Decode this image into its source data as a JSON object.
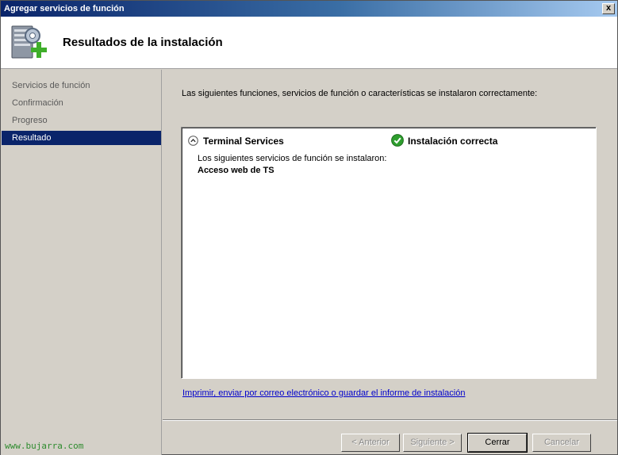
{
  "window": {
    "title": "Agregar servicios de función",
    "close_label": "x"
  },
  "header": {
    "title": "Resultados de la instalación",
    "icon": "server-gear-add-icon"
  },
  "sidebar": {
    "steps": [
      {
        "label": "Servicios de función",
        "active": false
      },
      {
        "label": "Confirmación",
        "active": false
      },
      {
        "label": "Progreso",
        "active": false
      },
      {
        "label": "Resultado",
        "active": true
      }
    ],
    "site": "www.bujarra.com"
  },
  "main": {
    "intro": "Las siguientes funciones, servicios de función o características se instalaron correctamente:",
    "results": [
      {
        "role": "Terminal Services",
        "status": "Instalación correcta",
        "detail": "Los siguientes servicios de función se instalaron:",
        "services": [
          "Acceso web de TS"
        ]
      }
    ],
    "report_link": "Imprimir, enviar por correo electrónico o guardar el informe de instalación"
  },
  "buttons": {
    "back": "< Anterior",
    "next": "Siguiente >",
    "close": "Cerrar",
    "cancel": "Cancelar"
  },
  "colors": {
    "titlebar": "#0a246a",
    "selection": "#0a246a",
    "link": "#0000cc",
    "site": "#2e8b2e",
    "success": "#2e9e2e"
  }
}
